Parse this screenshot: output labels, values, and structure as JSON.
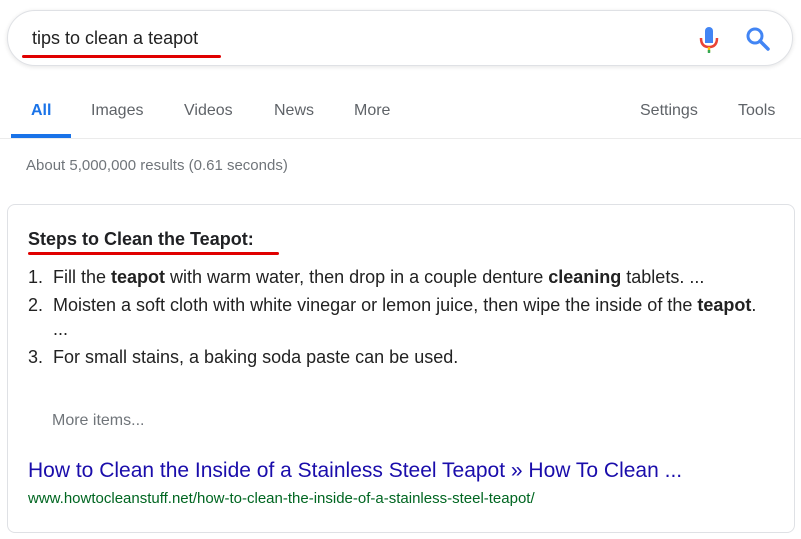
{
  "search": {
    "query": "tips to clean a teapot"
  },
  "tabs": [
    {
      "label": "All",
      "active": true
    },
    {
      "label": "Images"
    },
    {
      "label": "Videos"
    },
    {
      "label": "News"
    },
    {
      "label": "More"
    }
  ],
  "tools": [
    {
      "label": "Settings"
    },
    {
      "label": "Tools"
    }
  ],
  "result_stats": "About 5,000,000 results (0.61 seconds)",
  "snippet": {
    "title": "Steps to Clean the Teapot:",
    "steps": [
      {
        "number": "1.",
        "parts": [
          "Fill the ",
          "teapot",
          " with warm water, then drop in a couple denture ",
          "cleaning",
          " tablets. ..."
        ]
      },
      {
        "number": "2.",
        "parts": [
          "Moisten a soft cloth with white vinegar or lemon juice, then wipe the inside of the ",
          "teapot",
          ". ..."
        ]
      },
      {
        "number": "3.",
        "parts": [
          "For small stains, a baking soda paste can be used."
        ]
      }
    ],
    "more_items": "More items...",
    "link_title": "How to Clean the Inside of a Stainless Steel Teapot » How To Clean ...",
    "link_url": "www.howtocleanstuff.net/how-to-clean-the-inside-of-a-stainless-steel-teapot/"
  },
  "colors": {
    "accent": "#1a73e8",
    "annotation_underline": "#e00000",
    "link": "#1a0dab",
    "url": "#006621"
  }
}
